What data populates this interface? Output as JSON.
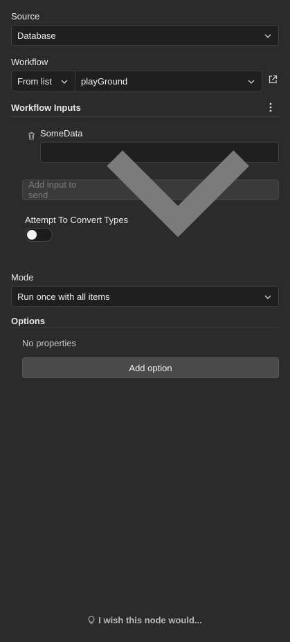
{
  "source": {
    "label": "Source",
    "value": "Database"
  },
  "workflow": {
    "label": "Workflow",
    "mode_value": "From list",
    "workflow_value": "playGround"
  },
  "workflow_inputs": {
    "title": "Workflow Inputs",
    "inputs": [
      {
        "name": "SomeData",
        "value": ""
      }
    ],
    "add_input_placeholder": "Add input to send",
    "convert_types_label": "Attempt To Convert Types",
    "convert_types_enabled": false
  },
  "mode": {
    "label": "Mode",
    "value": "Run once with all items"
  },
  "options": {
    "title": "Options",
    "empty_text": "No properties",
    "add_button_label": "Add option"
  },
  "footer": {
    "feedback_text": "I wish this node would..."
  },
  "icons": {
    "chevron": "chevron-down-icon",
    "external": "external-link-icon",
    "menu": "kebab-menu-icon",
    "trash": "trash-icon",
    "bulb": "lightbulb-icon"
  },
  "colors": {
    "background": "#2b2b2b",
    "field": "#1f1f1f",
    "border": "#3d3d3d",
    "button": "#4a4a4a"
  }
}
